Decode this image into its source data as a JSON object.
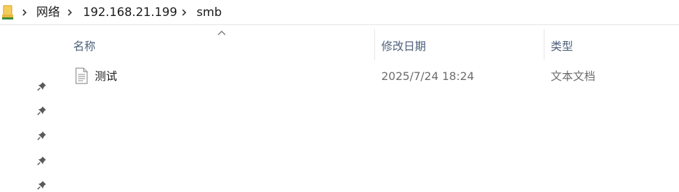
{
  "breadcrumb": {
    "items": [
      {
        "label": "网络"
      },
      {
        "label": "192.168.21.199"
      },
      {
        "label": "smb"
      }
    ]
  },
  "columns": {
    "name": "名称",
    "modified": "修改日期",
    "type": "类型"
  },
  "files": [
    {
      "name": "测试",
      "modified": "2025/7/24 18:24",
      "type": "文本文档",
      "icon": "text-document-icon"
    }
  ],
  "nav_pane": {
    "pin_icons": [
      "pin-icon",
      "pin-icon",
      "pin-icon",
      "pin-icon",
      "pin-icon"
    ]
  },
  "colors": {
    "header_text": "#4c607a",
    "secondary_text": "#6d6d6d",
    "divider": "#e5e5e5",
    "folder_yellow": "#e8b83a"
  }
}
